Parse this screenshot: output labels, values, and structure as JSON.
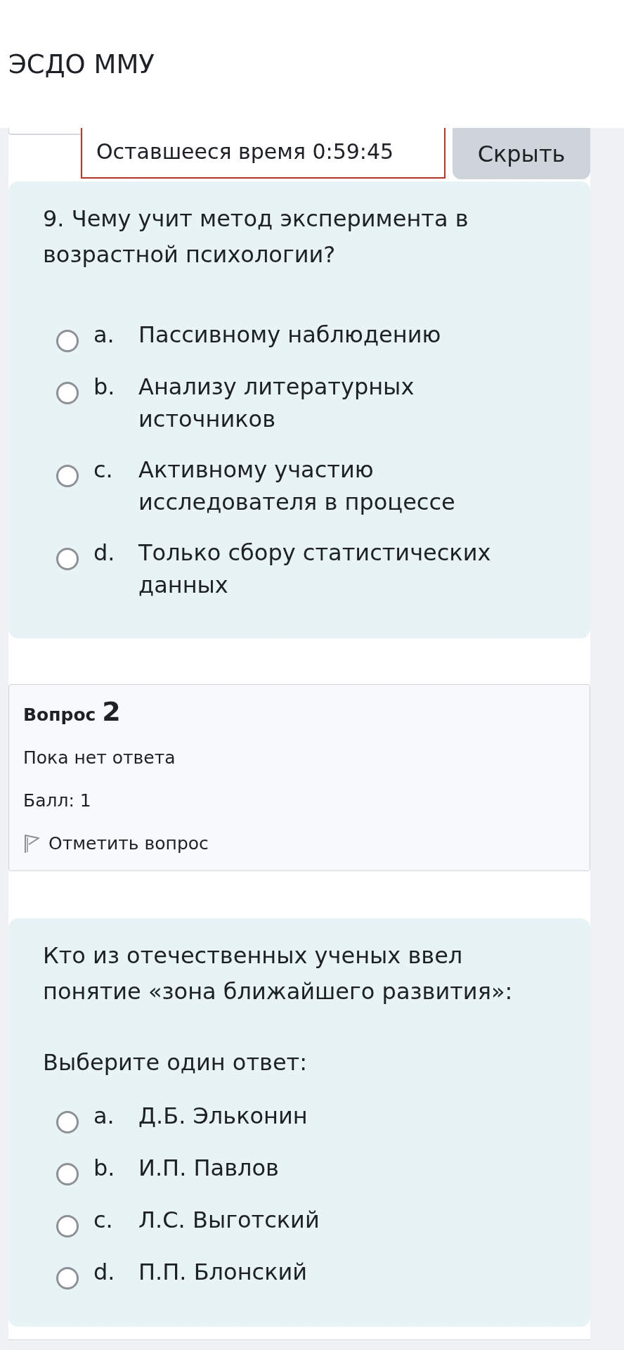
{
  "header": {
    "title": "ЭСДО ММУ"
  },
  "timer": {
    "text": "Оставшееся время 0:59:45",
    "hide_button": "Скрыть"
  },
  "questions": [
    {
      "text": "9. Чему учит метод эксперимента в возрастной психологии?",
      "options": [
        {
          "letter": "a.",
          "text": "Пассивному наблюдению",
          "selected": false
        },
        {
          "letter": "b.",
          "text": "Анализу литературных источников",
          "selected": false
        },
        {
          "letter": "c.",
          "text": "Активному участию исследователя в процессе",
          "selected": false
        },
        {
          "letter": "d.",
          "text": "Только сбору статистических данных",
          "selected": false
        }
      ]
    },
    {
      "info": {
        "title": "Вопрос",
        "number": "2",
        "status": "Пока нет ответа",
        "grade": "Балл: 1",
        "flag_label": "Отметить вопрос"
      },
      "text": "Кто из отечественных ученых ввел понятие «зона ближайшего развития»:",
      "prompt": "Выберите один ответ:",
      "options": [
        {
          "letter": "a.",
          "text": "Д.Б. Эльконин",
          "selected": false
        },
        {
          "letter": "b.",
          "text": "И.П. Павлов",
          "selected": false
        },
        {
          "letter": "c.",
          "text": "Л.С. Выготский",
          "selected": false
        },
        {
          "letter": "d.",
          "text": "П.П. Блонский",
          "selected": false
        }
      ]
    }
  ]
}
